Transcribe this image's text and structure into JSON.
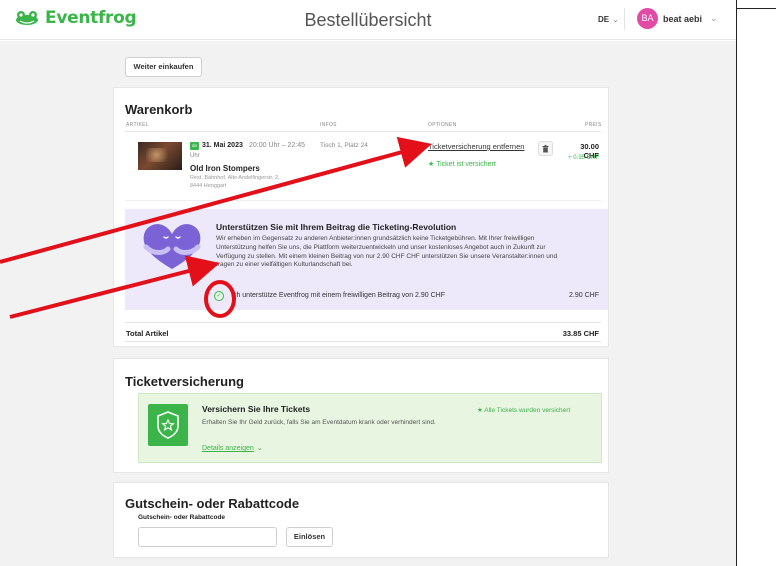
{
  "header": {
    "logo_text": "Eventfrog",
    "title": "Bestellübersicht",
    "language": "DE",
    "avatar_initials": "BA",
    "user_name": "beat aebi",
    "brand_color": "#3bb54a"
  },
  "continue_button": "Weiter einkaufen",
  "cart": {
    "title": "Warenkorb",
    "columns": [
      "ARTIKEL",
      "INFOS",
      "OPTIONEN",
      "PREIS"
    ],
    "item": {
      "date_badge": "do",
      "date": "31. Mai 2023",
      "time": "20:00 Uhr – 22:45",
      "time_cont": "Uhr",
      "name": "Old Iron Stompers",
      "venue_line1": "Rest. Bahnhof, Alte Andelfingerstr. 2,",
      "venue_line2": "8444 Henggart",
      "seat": "Tisch 1, Platz 24",
      "insurance_link": "Ticketversicherung entfernen",
      "insured_note": "Ticket ist versichert",
      "price": "30.00 CHF",
      "fee": "+ 0.95 CHF"
    },
    "donation": {
      "title": "Unterstützen Sie mit Ihrem Beitrag die Ticketing-Revolution",
      "text": "Wir erheben im Gegensatz zu anderen Anbieter:innen grundsätzlich keine Ticketgebühren. Mit Ihrer freiwilligen Unterstützung helfen Sie uns, die Plattform weiterzuentwickeln und unser kostenloses Angebot auch in Zukunft zur Verfügung zu stellen. Mit einem kleinen Beitrag von nur 2.90 CHF CHF unterstützen Sie unsere Veranstalter:innen und tragen zu einer vielfältigen Kulturlandschaft bei.",
      "checkbox_label": "Ich unterstütze Eventfrog mit einem freiwilligen Beitrag von 2.90 CHF",
      "checked": true,
      "price": "2.90 CHF"
    },
    "total_label": "Total Artikel",
    "total_value": "33.85 CHF"
  },
  "insurance": {
    "title": "Ticketversicherung",
    "box_title": "Versichern Sie Ihre Tickets",
    "box_text": "Erhalten Sie Ihr Geld zurück, falls Sie am Eventdatum krank oder verhindert sind.",
    "details_link": "Details anzeigen",
    "status": "Alle Tickets wurden versichert"
  },
  "coupon": {
    "title": "Gutschein- oder Rabattcode",
    "field_label": "Gutschein- oder Rabattcode",
    "value": "",
    "button": "Einlösen"
  },
  "annotation_color": "#e3101a"
}
